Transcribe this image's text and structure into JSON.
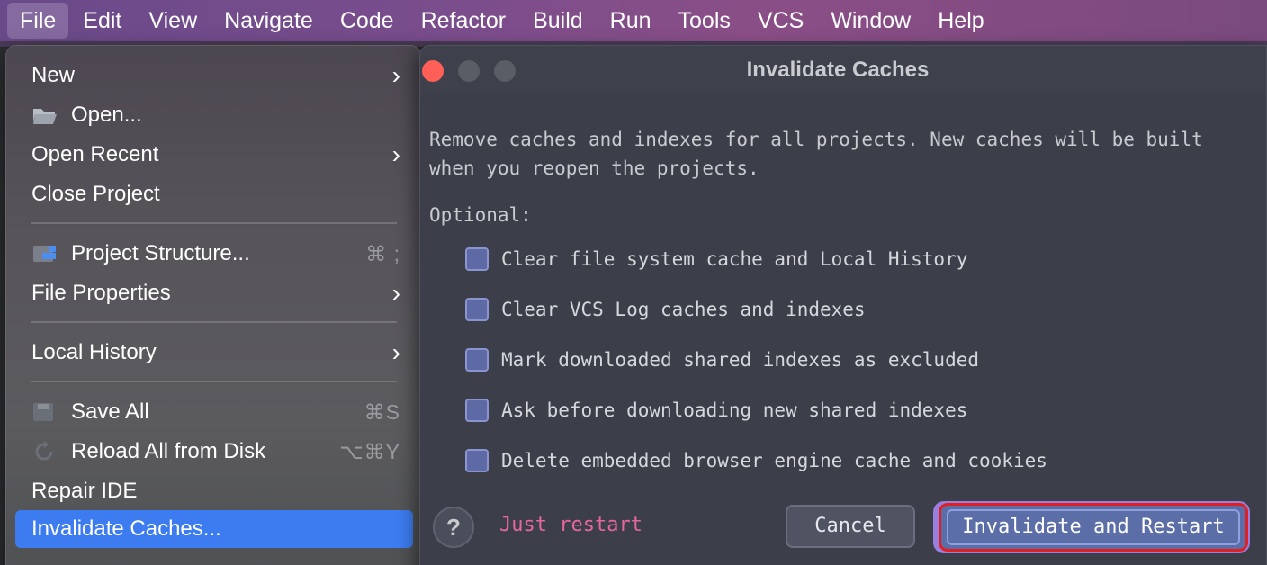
{
  "menubar": {
    "items": [
      "File",
      "Edit",
      "View",
      "Navigate",
      "Code",
      "Refactor",
      "Build",
      "Run",
      "Tools",
      "VCS",
      "Window",
      "Help"
    ],
    "active": "File"
  },
  "file_menu": {
    "new": "New",
    "open": "Open...",
    "open_recent": "Open Recent",
    "close_project": "Close Project",
    "project_structure": "Project Structure...",
    "project_structure_shortcut": "⌘ ;",
    "file_properties": "File Properties",
    "local_history": "Local History",
    "save_all": "Save All",
    "save_all_shortcut": "⌘S",
    "reload_all": "Reload All from Disk",
    "reload_all_shortcut": "⌥⌘Y",
    "repair_ide": "Repair IDE",
    "invalidate_caches": "Invalidate Caches..."
  },
  "dialog": {
    "title": "Invalidate Caches",
    "description_line1": "Remove caches and indexes for all projects. New caches will be built",
    "description_line2": "when you reopen the projects.",
    "optional_label": "Optional:",
    "options": [
      "Clear file system cache and Local History",
      "Clear VCS Log caches and indexes",
      "Mark downloaded shared indexes as excluded",
      "Ask before downloading new shared indexes",
      "Delete embedded browser engine cache and cookies"
    ],
    "help_glyph": "?",
    "just_restart": "Just restart",
    "cancel": "Cancel",
    "invalidate_restart": "Invalidate and Restart"
  },
  "colors": {
    "selection": "#3d7cf0",
    "highlight_ring": "#e02020",
    "link": "#e6669e",
    "close_button": "#ff5f57"
  },
  "icons": [
    "folder-icon",
    "project-structure-icon",
    "save-icon",
    "reload-icon",
    "chevron-right-icon",
    "help-icon"
  ]
}
